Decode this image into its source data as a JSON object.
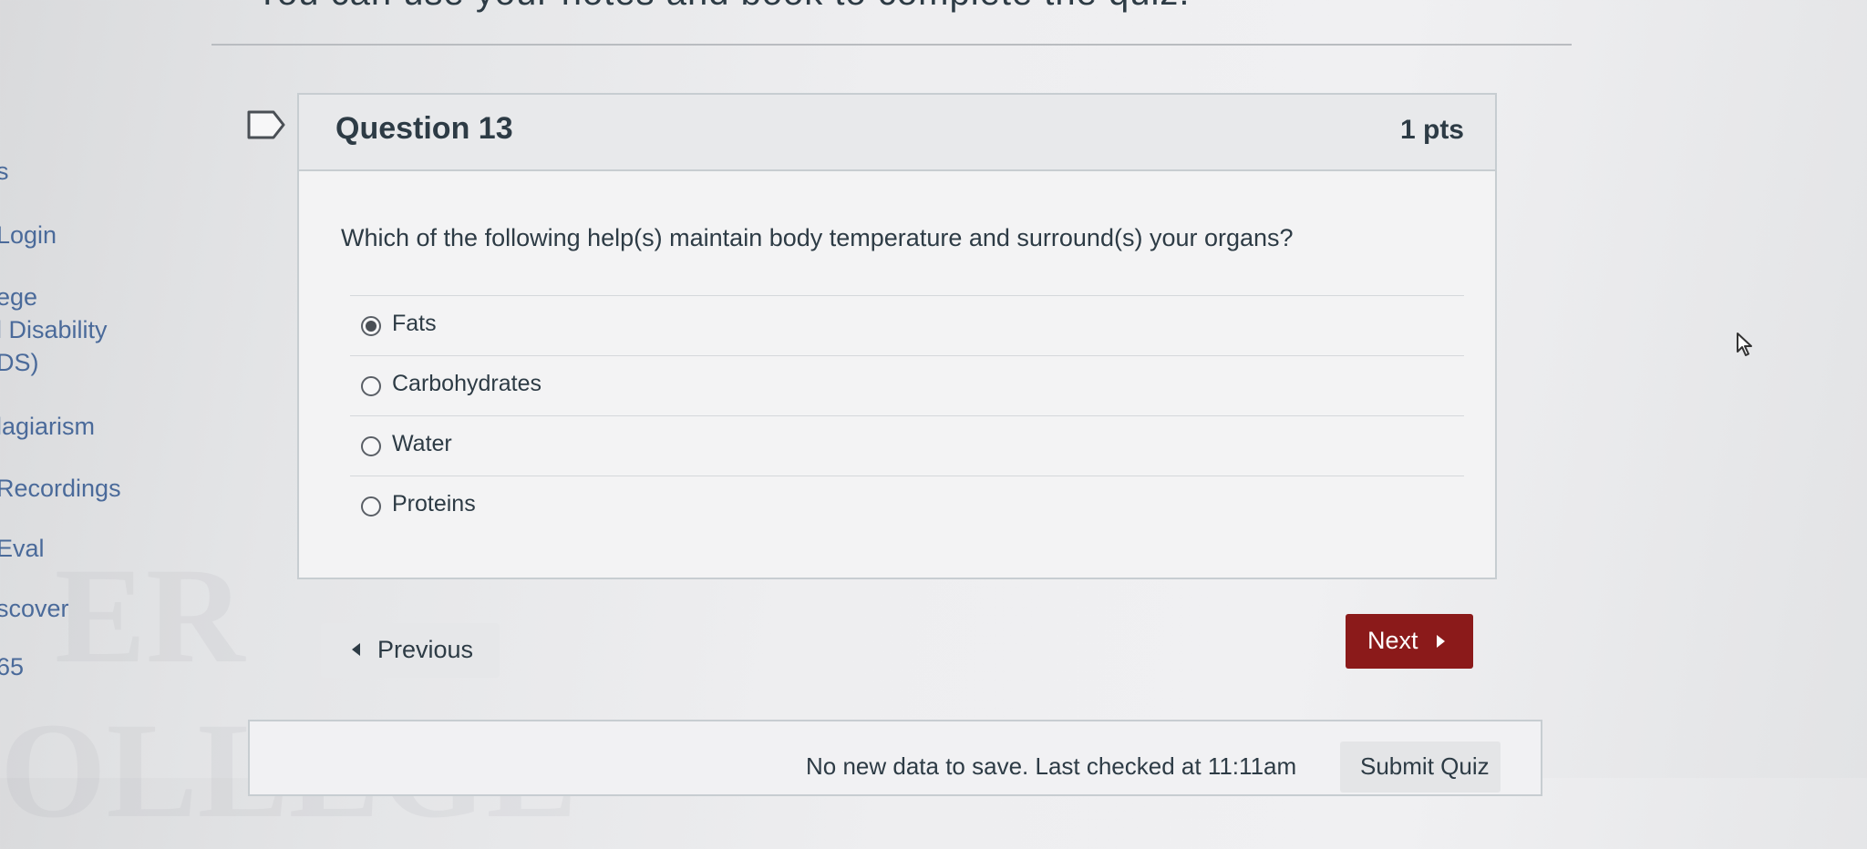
{
  "top_note": "You can use your notes and book to complete the quiz.",
  "sidebar": {
    "items": [
      {
        "label": "s"
      },
      {
        "label": "Login"
      },
      {
        "label": "ege"
      },
      {
        "label": "l Disability"
      },
      {
        "label": "DS)"
      },
      {
        "label": "lagiarism"
      },
      {
        "label": "Recordings"
      },
      {
        "label": "Eval"
      },
      {
        "label": "scover"
      },
      {
        "label": "65"
      }
    ]
  },
  "watermark": {
    "line1": "ER",
    "line2": "OLLEGE"
  },
  "question": {
    "title": "Question 13",
    "points": "1 pts",
    "text": "Which of the following help(s) maintain body temperature and surround(s) your organs?",
    "answers": [
      {
        "label": "Fats",
        "selected": true
      },
      {
        "label": "Carbohydrates",
        "selected": false
      },
      {
        "label": "Water",
        "selected": false
      },
      {
        "label": "Proteins",
        "selected": false
      }
    ]
  },
  "nav": {
    "previous_label": "Previous",
    "next_label": "Next"
  },
  "footer": {
    "save_status": "No new data to save. Last checked at 11:11am",
    "submit_label": "Submit Quiz"
  },
  "colors": {
    "next_button_bg": "#8b1a1a",
    "link_color": "#4a6a9a",
    "text_color": "#2d3b45"
  },
  "icons": {
    "flag": "flag-icon",
    "previous": "caret-left-icon",
    "next": "caret-right-icon",
    "cursor": "mouse-pointer-icon",
    "radio": "radio-icon"
  }
}
